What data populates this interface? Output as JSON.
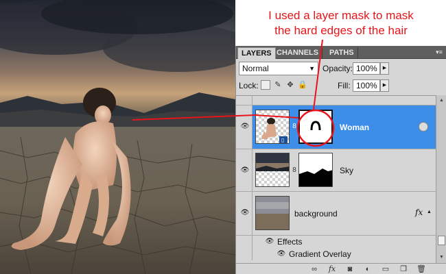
{
  "annotation": {
    "line1": "I used a layer mask to mask",
    "line2": "the hard edges of the hair",
    "color": "#e8141a"
  },
  "panel": {
    "tabs": [
      "LAYERS",
      "CHANNELS",
      "PATHS"
    ],
    "active_tab": "LAYERS",
    "menu_icon": "panel-menu-icon",
    "blend_mode": "Normal",
    "opacity_label": "Opacity:",
    "opacity_value": "100%",
    "lock_label": "Lock:",
    "fill_label": "Fill:",
    "fill_value": "100%",
    "lock_icons": [
      "lock-transparent-icon",
      "lock-paint-icon",
      "lock-move-icon",
      "lock-all-icon"
    ],
    "layers": [
      {
        "name": "Woman",
        "selected": true,
        "has_mask": true,
        "linked": true
      },
      {
        "name": "Sky",
        "selected": false,
        "has_mask": true,
        "linked": true
      },
      {
        "name": "background",
        "selected": false,
        "has_mask": false,
        "fx": "fx"
      }
    ],
    "effects_label": "Effects",
    "effect_items": [
      "Gradient Overlay"
    ],
    "selection_color": "#3c8ee8",
    "footer_icons": [
      "link-layers-icon",
      "fx-icon",
      "add-mask-icon",
      "adjustment-layer-icon",
      "group-folder-icon",
      "new-layer-icon",
      "trash-icon"
    ]
  }
}
